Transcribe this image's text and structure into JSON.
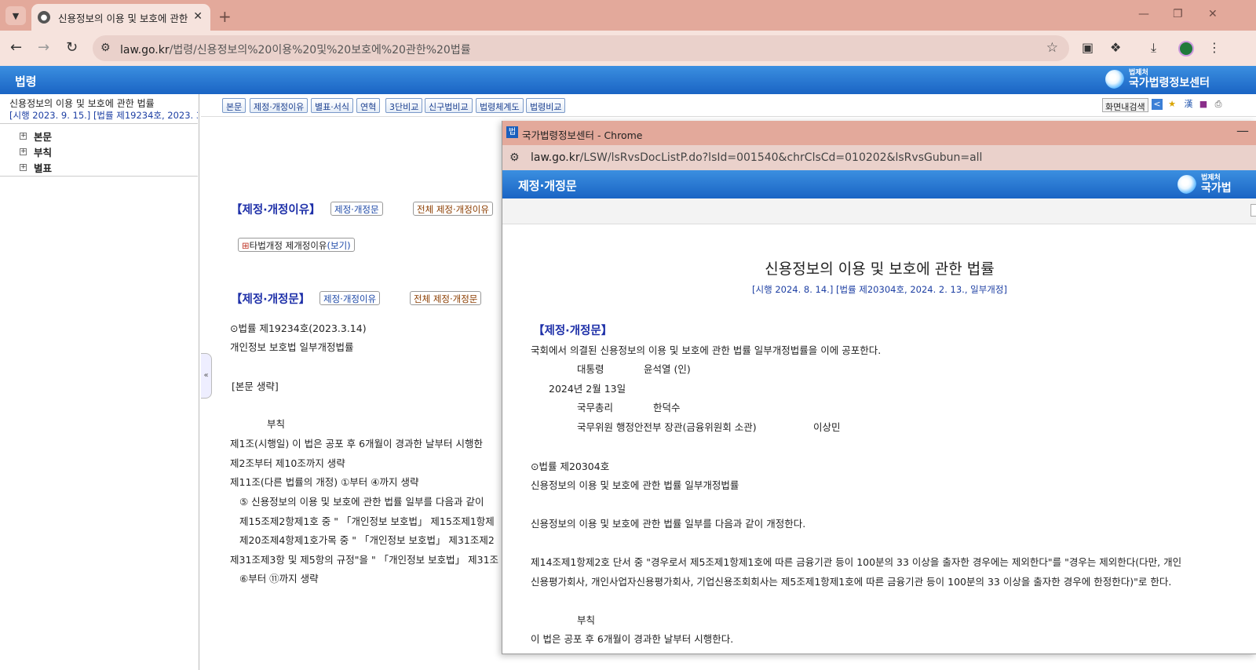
{
  "browser": {
    "tab_title": "신용정보의 이용 및 보호에 관한",
    "favicon": "법",
    "url_host": "law.go.kr",
    "url_path": "/법령/신용정보의%20이용%20및%20보호에%20관한%20법률"
  },
  "site": {
    "section_title": "법령",
    "logo_small": "법제처",
    "logo_big": "국가법령정보센터"
  },
  "left_panel": {
    "title": "신용정보의 이용 및 보호에 관한 법률",
    "subtitle": "[시행 2023. 9. 15.] [법률 제19234호, 2023. 3.",
    "tree": [
      "본문",
      "부칙",
      "별표"
    ]
  },
  "toolbar_buttons": [
    "본문",
    "제정·개정이유",
    "별표·서식",
    "연혁",
    "3단비교",
    "신구법비교",
    "법령체계도",
    "법령비교"
  ],
  "screen_search": "화면내검색",
  "main": {
    "reason_head": "【제정·개정이유】",
    "reason_btn1": "제정·개정문",
    "reason_btn2": "전체 제정·개정이유",
    "other_law_btn": "타법개정 제개정이유",
    "other_law_link": "(보기)",
    "text_head": "【제정·개정문】",
    "text_btn1": "제정·개정이유",
    "text_btn2": "전체 제정·개정문",
    "lines": [
      "⊙법률 제19234호(2023.3.14)",
      "개인정보 보호법 일부개정법률",
      "[본문 생략]",
      "부칙",
      "제1조(시행일) 이 법은 공포 후 6개월이 경과한 날부터 시행한",
      "제2조부터 제10조까지 생략",
      "제11조(다른 법률의 개정) ①부터 ④까지 생략",
      "⑤ 신용정보의 이용 및 보호에 관한 법률 일부를 다음과 같이",
      "제15조제2항제1호 중 \" 「개인정보 보호법」 제15조제1항제",
      "제20조제4항제1호가목 중 \" 「개인정보 보호법」 제31조제2",
      "제31조제3항 및 제5항의 규정\"을 \" 「개인정보 보호법」 제31조",
      "⑥부터 ⑪까지 생략"
    ]
  },
  "popup": {
    "window_title": "국가법령정보센터 - Chrome",
    "url_host": "law.go.kr",
    "url_path": "/LSW/lsRvsDocListP.do?lsId=001540&chrClsCd=010202&lsRvsGubun=all",
    "site_title": "제정·개정문",
    "logo_small": "법제처",
    "logo_big": "국가법",
    "law_title": "신용정보의 이용 및 보호에 관한 법률",
    "law_sub": "[시행 2024. 8. 14.] [법률 제20304호, 2024. 2. 13., 일부개정]",
    "head": "【제정·개정문】",
    "promulgation": "국회에서 의결된 신용정보의 이용 및 보호에 관한 법률 일부개정법률을 이에 공포한다.",
    "president_label": "대통령",
    "president_name": "윤석열 (인)",
    "date": "2024년 2월 13일",
    "pm_label": "국무총리",
    "pm_name": "한덕수",
    "minister_label": "국무위원 행정안전부 장관(금융위원회 소관)",
    "minister_name": "이상민",
    "law_no": "⊙법률 제20304호",
    "law_name": "신용정보의 이용 및 보호에 관한 법률 일부개정법률",
    "amend_intro": "신용정보의 이용 및 보호에 관한 법률 일부를 다음과 같이 개정한다.",
    "amend_line1": "제14조제1항제2호 단서 중 \"경우로서 제5조제1항제1호에 따른 금융기관 등이 100분의 33 이상을 출자한 경우에는 제외한다\"를 \"경우는 제외한다(다만, 개인",
    "amend_line2": "신용평가회사, 개인사업자신용평가회사, 기업신용조회회사는 제5조제1항제1호에 따른 금융기관 등이 100분의 33 이상을 출자한 경우에 한정한다)\"로 한다.",
    "supp_head": "부칙",
    "supp_line": "이 법은 공포 후 6개월이 경과한 날부터 시행한다."
  }
}
